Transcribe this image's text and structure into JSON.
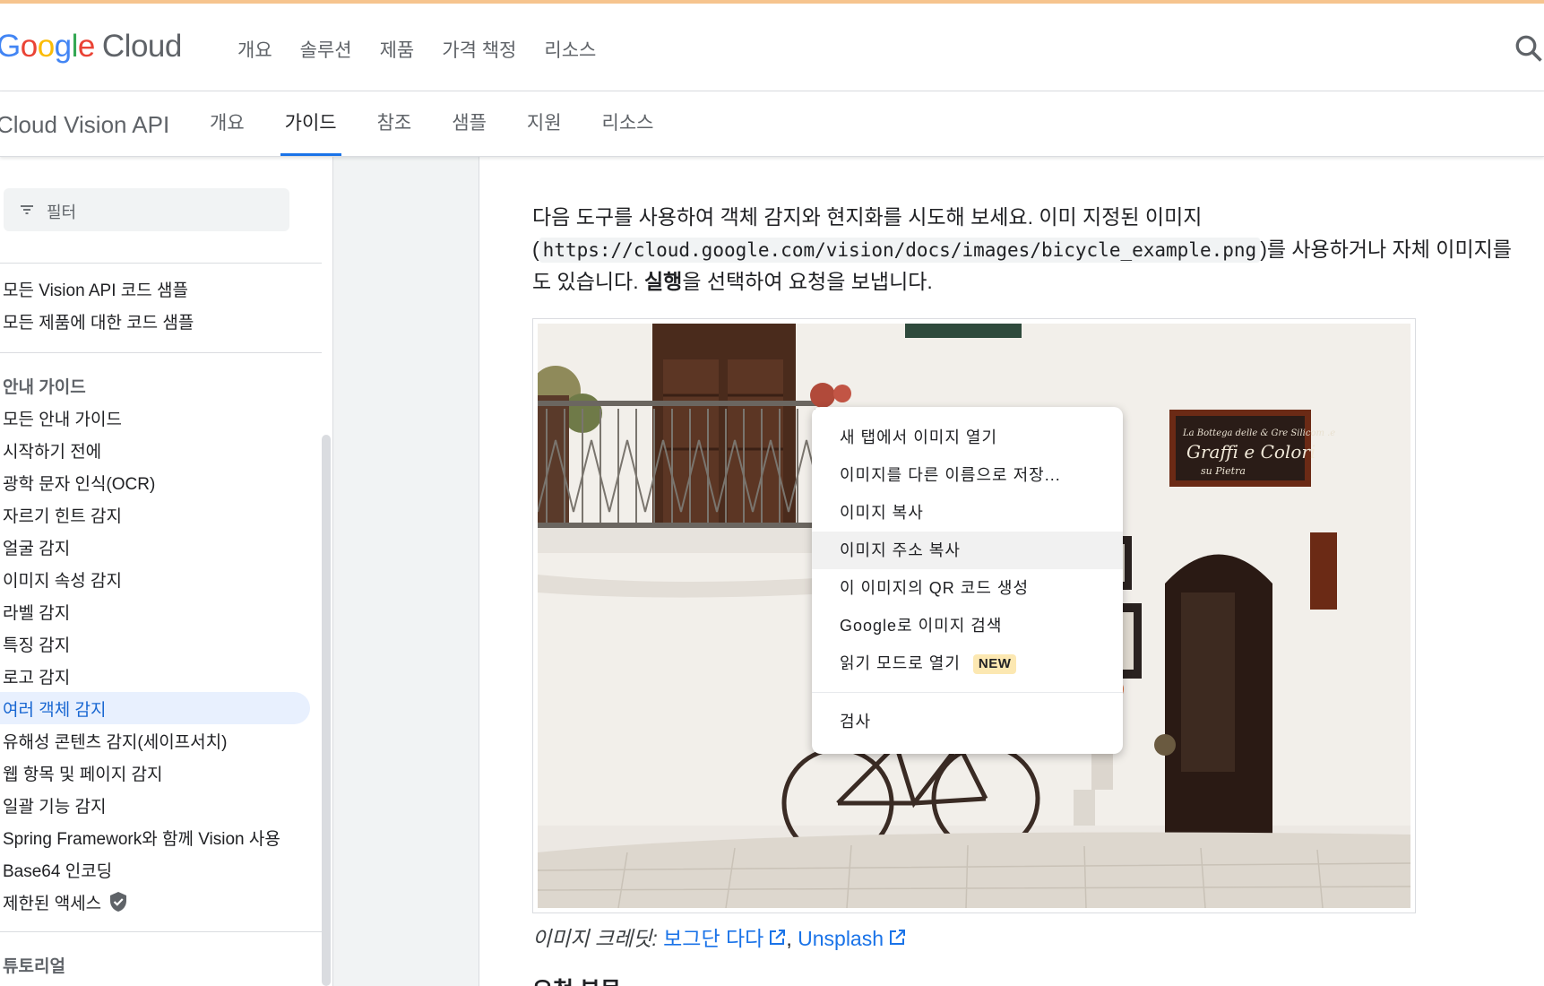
{
  "logo": {
    "g1": "G",
    "g2": "o",
    "g3": "o",
    "g4": "g",
    "g5": "l",
    "g6": "e",
    "cloud": "Cloud"
  },
  "top_nav": [
    "개요",
    "솔루션",
    "제품",
    "가격 책정",
    "리소스"
  ],
  "product": {
    "name": "Cloud Vision API",
    "tabs": [
      "개요",
      "가이드",
      "참조",
      "샘플",
      "지원",
      "리소스"
    ],
    "active_tab": "가이드"
  },
  "sidebar": {
    "filter_placeholder": "필터",
    "samples": [
      "모든 Vision API 코드 샘플",
      "모든 제품에 대한 코드 샘플"
    ],
    "guides_heading": "안내 가이드",
    "guides": [
      "모든 안내 가이드",
      "시작하기 전에",
      "광학 문자 인식(OCR)",
      "자르기 힌트 감지",
      "얼굴 감지",
      "이미지 속성 감지",
      "라벨 감지",
      "특징 감지",
      "로고 감지",
      "여러 객체 감지",
      "유해성 콘텐츠 감지(세이프서치)",
      "웹 항목 및 페이지 감지",
      "일괄 기능 감지",
      "Spring Framework와 함께 Vision 사용",
      "Base64 인코딩",
      "제한된 액세스"
    ],
    "active_item": "여러 객체 감지",
    "tutorials_heading": "튜토리얼"
  },
  "content": {
    "line1": "다음 도구를 사용하여 객체 감지와 현지화를 시도해 보세요. 이미 지정된 이미지",
    "line2_open": "(",
    "line2_code": "https://cloud.google.com/vision/docs/images/bicycle_example.png",
    "line2_rest": ")를 사용하거나 자체 이미지를",
    "line3_a": "도 있습니다. ",
    "line3_bold": "실행",
    "line3_b": "을 선택하여 요청을 보냅니다.",
    "credit_label": "이미지 크레딧:",
    "credit_link1": "보그단 다다",
    "credit_sep": ",",
    "credit_link2": "Unsplash",
    "next_heading": "요청 본문"
  },
  "context_menu": {
    "items": [
      "새 탭에서 이미지 열기",
      "이미지를 다른 이름으로 저장...",
      "이미지 복사",
      "이미지 주소 복사",
      "이 이미지의 QR 코드 생성",
      "Google로 이미지 검색",
      "읽기 모드로 열기"
    ],
    "highlighted": "이미지 주소 복사",
    "new_badge": "NEW",
    "inspect": "검사"
  },
  "sign": {
    "line1": "La Bottega delle & Gre Silicom .e",
    "line2": "Graffi e Colori",
    "line3": "su    Pietra"
  },
  "colors": {
    "accent": "#1a73e8",
    "active_bg": "#e8f0fe",
    "badge_bg": "#fce8b2"
  }
}
